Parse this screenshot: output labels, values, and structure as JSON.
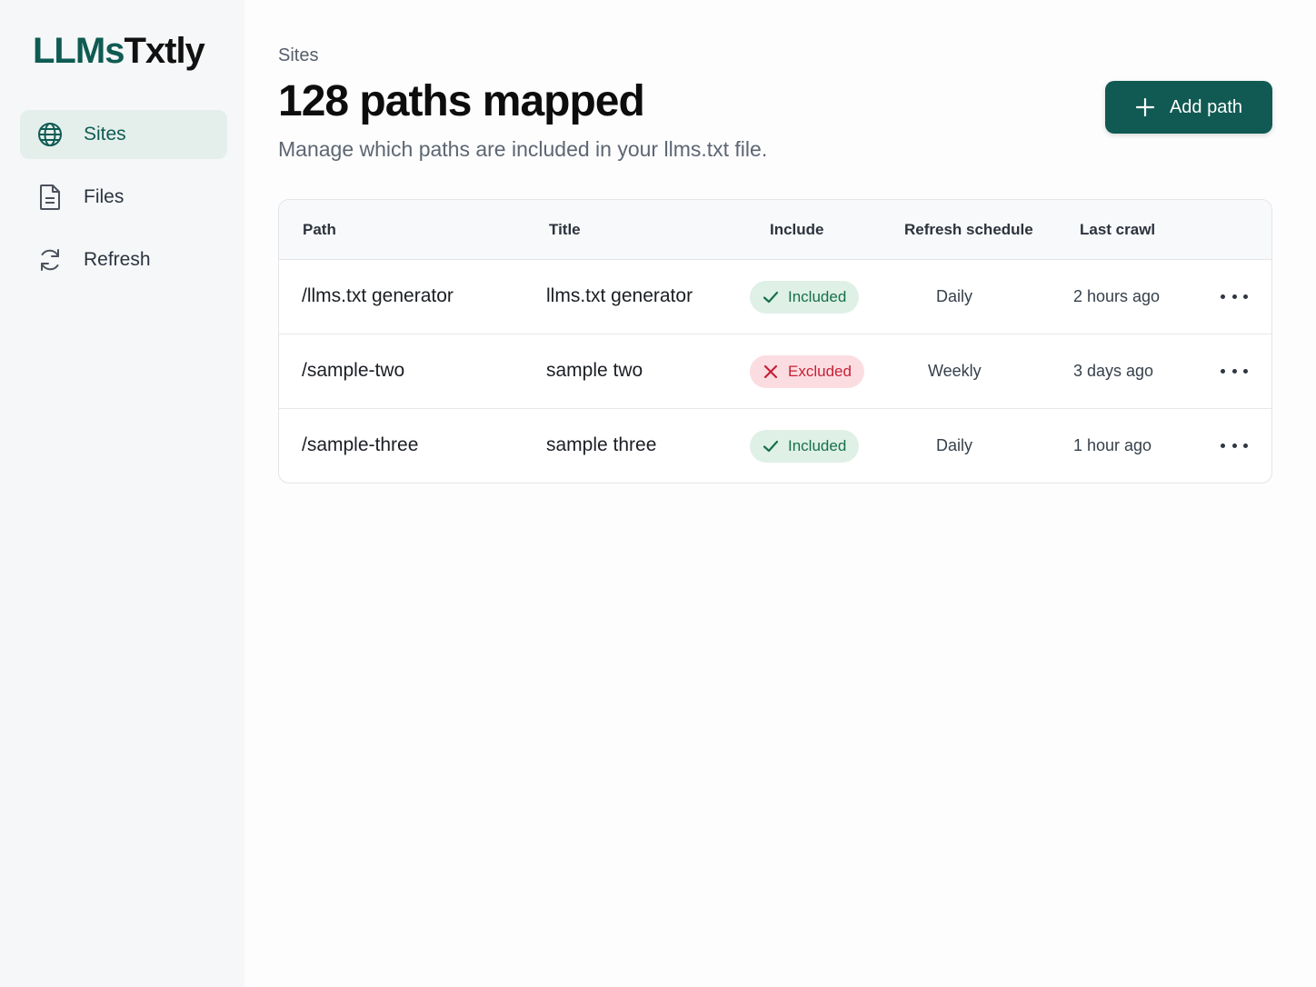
{
  "app": {
    "logo_part1": "LLMs",
    "logo_part2": "Txtly",
    "brand_color": "#0f5b53"
  },
  "sidebar": {
    "items": [
      {
        "label": "Sites",
        "icon": "globe-icon",
        "active": true
      },
      {
        "label": "Files",
        "icon": "file-icon",
        "active": false
      },
      {
        "label": "Refresh",
        "icon": "refresh-icon",
        "active": false
      }
    ]
  },
  "header": {
    "breadcrumb": "Sites",
    "title": "128 paths mapped",
    "subtitle": "Manage which paths are included in your llms.txt file.",
    "add_button_label": "Add path"
  },
  "table": {
    "columns": [
      "Path",
      "Title",
      "Include",
      "Refresh schedule",
      "Last crawl"
    ],
    "rows": [
      {
        "path": "/llms.txt generator",
        "title": "llms.txt generator",
        "include": "Included",
        "include_status": "included",
        "schedule": "Daily",
        "last_crawl": "2 hours ago"
      },
      {
        "path": "/sample-two",
        "title": "sample two",
        "include": "Excluded",
        "include_status": "excluded",
        "schedule": "Weekly",
        "last_crawl": "3 days ago"
      },
      {
        "path": "/sample-three",
        "title": "sample three",
        "include": "Included",
        "include_status": "included",
        "schedule": "Daily",
        "last_crawl": "1 hour ago"
      }
    ]
  },
  "colors": {
    "included_bg": "#dff0e7",
    "included_fg": "#17704a",
    "excluded_bg": "#fbdde1",
    "excluded_fg": "#c61f36",
    "button_bg": "#115a53"
  }
}
